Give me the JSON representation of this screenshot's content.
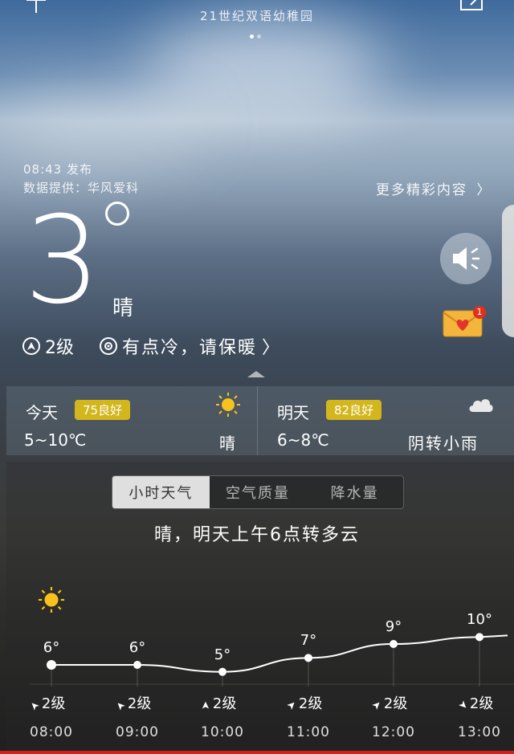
{
  "header": {
    "title": "21世纪双语幼稚园"
  },
  "publish": {
    "time_label": "08:43 发布",
    "provider_label": "数据提供：华风爱科"
  },
  "more_link": "更多精彩内容",
  "current": {
    "temp": "3",
    "condition": "晴",
    "wind": "2级",
    "tip": "有点冷，请保暖"
  },
  "mail": {
    "badge": "1"
  },
  "today": {
    "label": "今天",
    "aqi": "75良好",
    "range": "5~10℃",
    "condition": "晴",
    "icon": "sun-icon"
  },
  "tomorrow": {
    "label": "明天",
    "aqi": "82良好",
    "range": "6~8℃",
    "condition": "阴转小雨",
    "icon": "cloud-icon"
  },
  "tabs": [
    {
      "label": "小时天气",
      "active": true
    },
    {
      "label": "空气质量",
      "active": false
    },
    {
      "label": "降水量",
      "active": false
    }
  ],
  "summary": "晴，明天上午6点转多云",
  "hourly": [
    {
      "time": "08:00",
      "temp": "6°",
      "wind": "2级",
      "temp_value": 6
    },
    {
      "time": "09:00",
      "temp": "6°",
      "wind": "2级",
      "temp_value": 6
    },
    {
      "time": "10:00",
      "temp": "5°",
      "wind": "2级",
      "temp_value": 5
    },
    {
      "time": "11:00",
      "temp": "7°",
      "wind": "2级",
      "temp_value": 7
    },
    {
      "time": "12:00",
      "temp": "9°",
      "wind": "2级",
      "temp_value": 9
    },
    {
      "time": "13:00",
      "temp": "10°",
      "wind": "2级",
      "temp_value": 10
    }
  ],
  "colors": {
    "aqi_badge": "#d3b61c",
    "active_tab": "#ffffff",
    "alert_badge": "#e2301d"
  }
}
